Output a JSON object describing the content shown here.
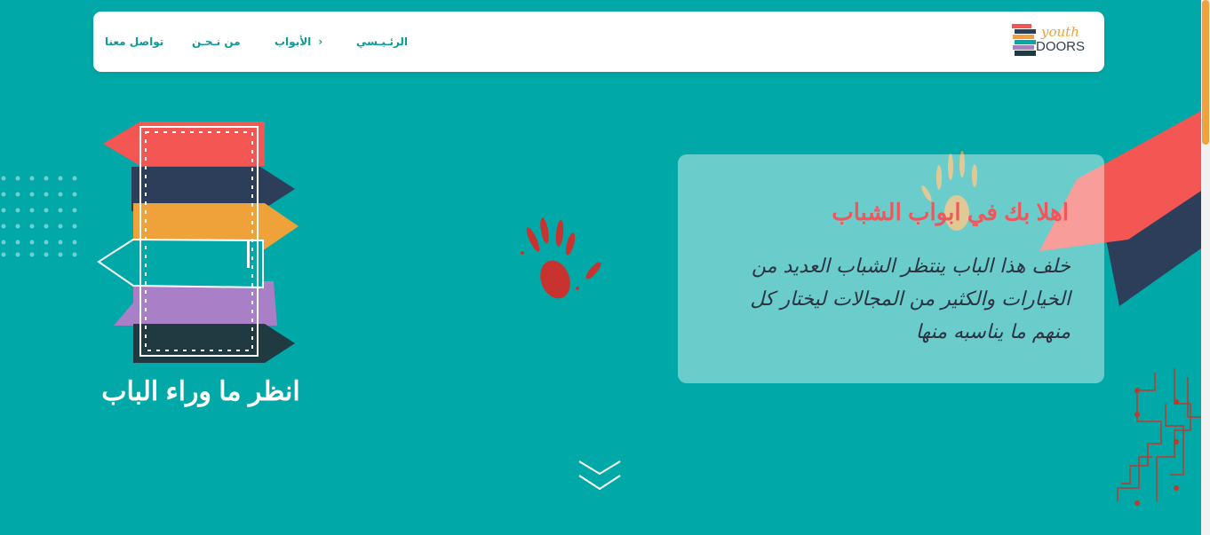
{
  "brand": {
    "logo_word_top": "youth",
    "logo_word_bottom": "DOORS"
  },
  "nav": {
    "home": "الرئـيـسي",
    "doors": "الأبواب",
    "about": "من نـحـن",
    "contact": "تواصل معنا"
  },
  "hero": {
    "title": "اهلا بك في ابواب الشباب",
    "text": "خلف هذا الباب ينتظر الشباب العديد من الخيارات والكثير من المجالات ليختار كل منهم ما يناسبه منها",
    "door_heading": "انظر ما وراء الباب"
  },
  "icons": {
    "doors_chevron": "chevron-left-icon",
    "scroll_down": "double-chevron-down-icon"
  },
  "colors": {
    "background": "#00a8a8",
    "nav_text": "#0c9a97",
    "title": "#f0565a",
    "accent_orange": "#f0a23a",
    "navy": "#2c3e5a"
  }
}
